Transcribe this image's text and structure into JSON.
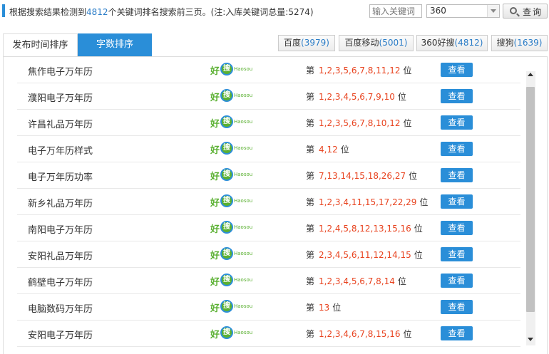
{
  "summary": {
    "prefix": "根据搜索结果检测到",
    "count": "4812",
    "suffix": "个关键词排名搜索前三页。(注:入库关键词总量:5274)"
  },
  "search": {
    "placeholder": "输入关键词",
    "engine_value": "360",
    "query_label": "查询"
  },
  "tabs": [
    {
      "label": "发布时间排序"
    },
    {
      "label": "字数排序"
    }
  ],
  "engines": [
    {
      "name": "百度",
      "count": "(3979)"
    },
    {
      "name": "百度移动",
      "count": "(5001)"
    },
    {
      "name": "360好搜",
      "count": "(4812)"
    },
    {
      "name": "搜狗",
      "count": "(1639)"
    }
  ],
  "labels": {
    "rank_prefix": "第",
    "rank_suffix": "位",
    "view": "查看",
    "logo_hao": "好",
    "logo_sou": "搜",
    "logo_sub": "Haosou"
  },
  "rows": [
    {
      "keyword": "焦作电子万年历",
      "positions": "1,2,3,5,6,7,8,11,12"
    },
    {
      "keyword": "濮阳电子万年历",
      "positions": "1,2,3,4,5,6,7,9,10"
    },
    {
      "keyword": "许昌礼品万年历",
      "positions": "1,2,3,5,6,7,8,10,12"
    },
    {
      "keyword": "电子万年历样式",
      "positions": "4,12"
    },
    {
      "keyword": "电子万年历功率",
      "positions": "7,13,14,15,18,26,27"
    },
    {
      "keyword": "新乡礼品万年历",
      "positions": "1,2,3,4,11,15,17,22,29"
    },
    {
      "keyword": "南阳电子万年历",
      "positions": "1,2,4,5,8,12,13,15,16"
    },
    {
      "keyword": "安阳礼品万年历",
      "positions": "2,3,4,5,6,11,12,14,15"
    },
    {
      "keyword": "鹤壁电子万年历",
      "positions": "1,2,3,4,5,6,7,8,14"
    },
    {
      "keyword": "电脑数码万年历",
      "positions": "13"
    },
    {
      "keyword": "安阳电子万年历",
      "positions": "1,2,3,4,6,7,8,15,16"
    }
  ],
  "colors": {
    "accent": "#2a8ed8",
    "rank": "#e8431f",
    "count": "#2a7cc7",
    "logo_green": "#5ab031"
  }
}
